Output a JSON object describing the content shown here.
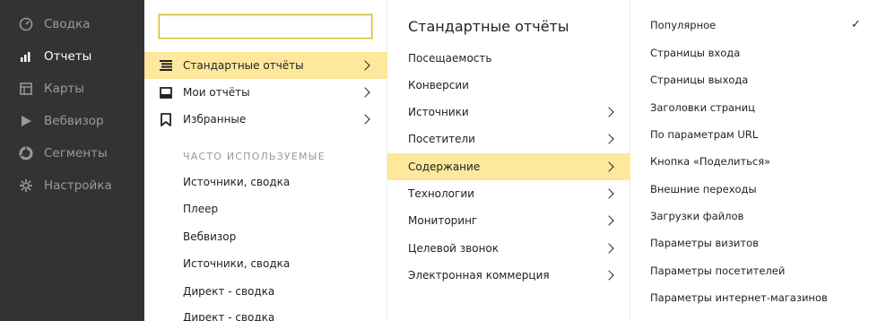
{
  "nav": {
    "items": [
      {
        "label": "Сводка",
        "icon": "dashboard-icon"
      },
      {
        "label": "Отчеты",
        "icon": "bar-chart-icon"
      },
      {
        "label": "Карты",
        "icon": "map-icon"
      },
      {
        "label": "Вебвизор",
        "icon": "play-icon"
      },
      {
        "label": "Сегменты",
        "icon": "segments-icon"
      },
      {
        "label": "Настройка",
        "icon": "gear-icon"
      }
    ],
    "active_index": 1
  },
  "search": {
    "value": "",
    "placeholder": ""
  },
  "report_menu": {
    "items": [
      {
        "label": "Стандартные отчёты",
        "icon": "list-icon"
      },
      {
        "label": "Мои отчёты",
        "icon": "inbox-icon"
      },
      {
        "label": "Избранные",
        "icon": "bookmark-icon"
      }
    ],
    "frequent_title": "ЧАСТО ИСПОЛЬЗУЕМЫЕ",
    "frequent": [
      "Источники, сводка",
      "Плеер",
      "Вебвизор",
      "Источники, сводка",
      "Директ - сводка",
      "Директ - сводка"
    ]
  },
  "standard_reports": {
    "title": "Стандартные отчёты",
    "items": [
      {
        "label": "Посещаемость"
      },
      {
        "label": "Конверсии"
      },
      {
        "label": "Источники"
      },
      {
        "label": "Посетители"
      },
      {
        "label": "Содержание"
      },
      {
        "label": "Технологии"
      },
      {
        "label": "Мониторинг"
      },
      {
        "label": "Целевой звонок"
      },
      {
        "label": "Электронная коммерция"
      }
    ]
  },
  "content_reports": {
    "checkmark": "✓",
    "items": [
      "Популярное",
      "Страницы входа",
      "Страницы выхода",
      "Заголовки страниц",
      "По параметрам URL",
      "Кнопка «Поделиться»",
      "Внешние переходы",
      "Загрузки файлов",
      "Параметры визитов",
      "Параметры посетителей",
      "Параметры интернет-магазинов"
    ]
  },
  "colors": {
    "nav_bg": "#333333",
    "highlight": "#fde89c",
    "active_text": "#ffffff",
    "muted_text": "#9a9a9a"
  }
}
